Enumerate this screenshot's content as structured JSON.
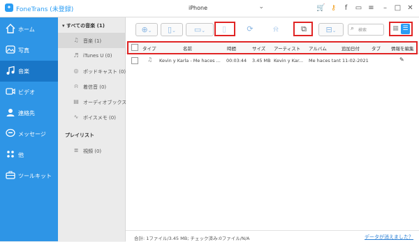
{
  "app": {
    "title": "FoneTrans (未登録)",
    "device": "iPhone"
  },
  "sidebar": {
    "items": [
      {
        "label": "ホーム"
      },
      {
        "label": "写真"
      },
      {
        "label": "音楽"
      },
      {
        "label": "ビデオ"
      },
      {
        "label": "連絡先"
      },
      {
        "label": "メッセージ"
      },
      {
        "label": "他"
      },
      {
        "label": "ツールキット"
      }
    ],
    "active": "音楽"
  },
  "panel": {
    "all_music": "すべての音楽 (1)",
    "categories": [
      {
        "label": "音楽 (1)"
      },
      {
        "label": "iTunes U (0)"
      },
      {
        "label": "ポッドキャスト (0)"
      },
      {
        "label": "着信音 (0)"
      },
      {
        "label": "オーディオブックス (0)"
      },
      {
        "label": "ボイスメモ (0)"
      }
    ],
    "playlist_header": "プレイリスト",
    "playlists": [
      {
        "label": "視頻 (0)"
      }
    ]
  },
  "toolbar": {
    "search_placeholder": "検索"
  },
  "table": {
    "headers": [
      "タイプ",
      "名前",
      "時間",
      "サイズ",
      "アーティスト",
      "アルバム",
      "追加日付",
      "タブ",
      "情報を編集"
    ],
    "rows": [
      {
        "name": "Kevin y Karla - Me haces ...",
        "time": "00:03:44",
        "size": "3.45 MB",
        "artist": "Kevin y Kar...",
        "album": "Me haces tant...",
        "date": "11-02-2021"
      }
    ]
  },
  "status": {
    "summary": "合計: 1ファイル/3.45 MB; チェック済み:0ファイル/N/A",
    "link": "データが消えました？"
  },
  "colors": {
    "sidebar": "#2e95e6",
    "sidebar_active": "#1976c7",
    "accent": "#2a9df4",
    "highlight": "#e02424"
  }
}
